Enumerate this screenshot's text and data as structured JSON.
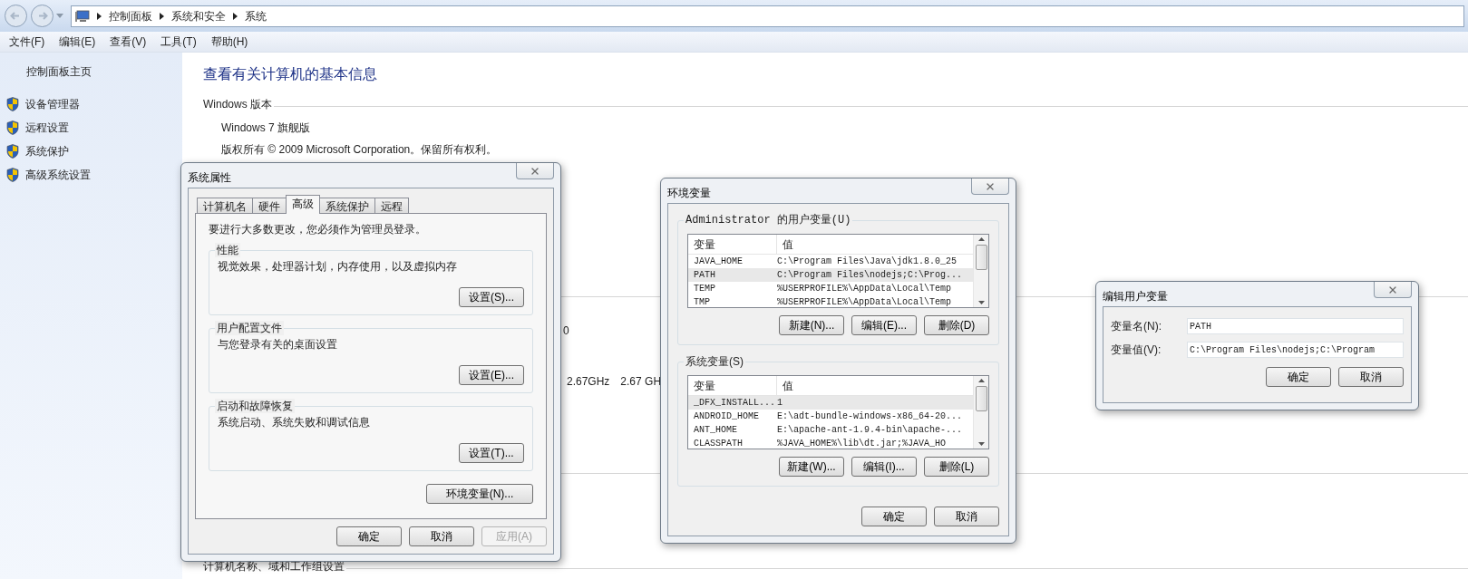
{
  "explorer": {
    "breadcrumb": [
      "控制面板",
      "系统和安全",
      "系统"
    ],
    "menu": [
      "文件(F)",
      "编辑(E)",
      "查看(V)",
      "工具(T)",
      "帮助(H)"
    ],
    "sidebar": {
      "home": "控制面板主页",
      "links": [
        "设备管理器",
        "远程设置",
        "系统保护",
        "高级系统设置"
      ]
    },
    "content": {
      "title": "查看有关计算机的基本信息",
      "section_windows": "Windows 版本",
      "edition": "Windows 7 旗舰版",
      "copyright": "版权所有 © 2009 Microsoft Corporation。保留所有权利。",
      "partial_line_1": "0",
      "partial_line_2": [
        "2.67GHz",
        "2.67 GH"
      ],
      "section_bottom": "计算机名称、域和工作组设置"
    }
  },
  "system_properties": {
    "title": "系统属性",
    "tabs": [
      {
        "label": "计算机名",
        "selected": false
      },
      {
        "label": "硬件",
        "selected": false
      },
      {
        "label": "高级",
        "selected": true
      },
      {
        "label": "系统保护",
        "selected": false
      },
      {
        "label": "远程",
        "selected": false
      }
    ],
    "notice": "要进行大多数更改，您必须作为管理员登录。",
    "groups": [
      {
        "title": "性能",
        "description": "视觉效果，处理器计划，内存使用，以及虚拟内存",
        "button": "设置(S)..."
      },
      {
        "title": "用户配置文件",
        "description": "与您登录有关的桌面设置",
        "button": "设置(E)..."
      },
      {
        "title": "启动和故障恢复",
        "description": "系统启动、系统失败和调试信息",
        "button": "设置(T)..."
      }
    ],
    "env_button": "环境变量(N)...",
    "buttons": [
      {
        "label": "确定",
        "disabled": false
      },
      {
        "label": "取消",
        "disabled": false
      },
      {
        "label": "应用(A)",
        "disabled": true
      }
    ]
  },
  "environment_variables": {
    "title": "环境变量",
    "lists": [
      {
        "title": "Administrator 的用户变量(U)",
        "columns": [
          "变量",
          "值"
        ],
        "rows": [
          {
            "name": "JAVA_HOME",
            "value": "C:\\Program Files\\Java\\jdk1.8.0_25",
            "selected": false
          },
          {
            "name": "PATH",
            "value": "C:\\Program Files\\nodejs;C:\\Prog...",
            "selected": true
          },
          {
            "name": "TEMP",
            "value": "%USERPROFILE%\\AppData\\Local\\Temp",
            "selected": false
          },
          {
            "name": "TMP",
            "value": "%USERPROFILE%\\AppData\\Local\\Temp",
            "selected": false
          }
        ],
        "buttons": [
          "新建(N)...",
          "编辑(E)...",
          "删除(D)"
        ]
      },
      {
        "title": "系统变量(S)",
        "columns": [
          "变量",
          "值"
        ],
        "rows": [
          {
            "name": "_DFX_INSTALL...",
            "value": "1",
            "selected": true
          },
          {
            "name": "ANDROID_HOME",
            "value": "E:\\adt-bundle-windows-x86_64-20...",
            "selected": false
          },
          {
            "name": "ANT_HOME",
            "value": "E:\\apache-ant-1.9.4-bin\\apache-...",
            "selected": false
          },
          {
            "name": "CLASSPATH",
            "value": "%JAVA_HOME%\\lib\\dt.jar;%JAVA_HO",
            "selected": false
          }
        ],
        "buttons": [
          "新建(W)...",
          "编辑(I)...",
          "删除(L)"
        ]
      }
    ],
    "buttons": [
      "确定",
      "取消"
    ]
  },
  "edit_variable": {
    "title": "编辑用户变量",
    "fields": [
      {
        "label": "变量名(N):",
        "value": "PATH"
      },
      {
        "label": "变量值(V):",
        "value": "C:\\Program Files\\nodejs;C:\\Program"
      }
    ],
    "buttons": [
      "确定",
      "取消"
    ]
  }
}
